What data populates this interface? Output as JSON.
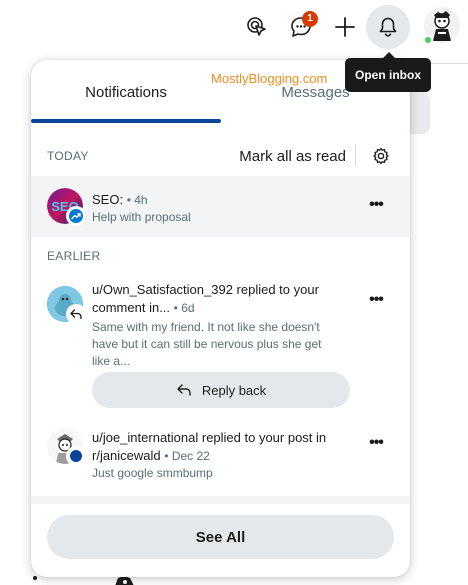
{
  "topbar": {
    "chat_badge": "1",
    "tooltip": "Open inbox",
    "icons": [
      "advertise-icon",
      "chat-icon",
      "plus-icon",
      "bell-icon",
      "user-avatar"
    ]
  },
  "watermark": "MostlyBlogging.com",
  "panel": {
    "tabs": [
      {
        "label": "Notifications",
        "active": true
      },
      {
        "label": "Messages",
        "active": false
      }
    ],
    "today": {
      "title": "TODAY",
      "mark_all_label": "Mark all as read"
    },
    "earlier": {
      "title": "EARLIER"
    },
    "notifications": [
      {
        "title": "SEO:",
        "time": "• 4h",
        "text": "Help with proposal",
        "unread": true
      },
      {
        "title_line1": "u/Own_Satisfaction_392 replied to your",
        "title_line2": "comment in...",
        "time": "• 6d",
        "text_line1": "Same with my friend. It not like she doesn't",
        "text_line2": "have but it can still be nervous plus she get",
        "text_line3": "like a...",
        "reply_label": "Reply back"
      },
      {
        "title_line1": "u/joe_international replied to your post in",
        "title_line2": "r/janicewald",
        "time": "• Dec 22",
        "text": "Just google smmbump"
      }
    ],
    "see_all_label": "See All"
  },
  "colors": {
    "accent": "#0a449b",
    "badge": "#d93a00",
    "watermark": "#f28c1e",
    "button_bg": "#e4e8eb",
    "unread_bg": "#f2f4f5"
  }
}
